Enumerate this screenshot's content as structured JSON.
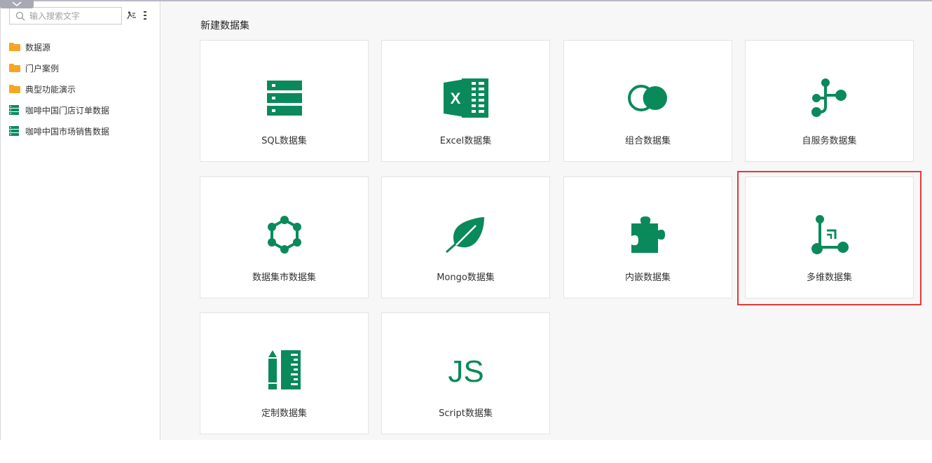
{
  "sidebar": {
    "search": {
      "placeholder": "输入搜索文字",
      "value": ""
    },
    "tree": [
      {
        "label": "数据源",
        "icon": "folder-icon"
      },
      {
        "label": "门户案例",
        "icon": "folder-icon"
      },
      {
        "label": "典型功能演示",
        "icon": "folder-icon"
      },
      {
        "label": "咖啡中国门店订单数据",
        "icon": "dataset-icon"
      },
      {
        "label": "咖啡中国市场销售数据",
        "icon": "dataset-icon"
      }
    ]
  },
  "main": {
    "title": "新建数据集",
    "cards": [
      {
        "label": "SQL数据集",
        "icon": "sql-table-icon"
      },
      {
        "label": "Excel数据集",
        "icon": "excel-icon"
      },
      {
        "label": "组合数据集",
        "icon": "combine-circles-icon"
      },
      {
        "label": "自服务数据集",
        "icon": "self-service-flow-icon"
      },
      {
        "label": "数据集市数据集",
        "icon": "hexagon-network-icon"
      },
      {
        "label": "Mongo数据集",
        "icon": "leaf-icon"
      },
      {
        "label": "内嵌数据集",
        "icon": "puzzle-icon"
      },
      {
        "label": "多维数据集",
        "icon": "cube-axis-icon"
      },
      {
        "label": "定制数据集",
        "icon": "pencil-ruler-icon"
      },
      {
        "label": "Script数据集",
        "icon": "js-icon"
      }
    ]
  },
  "colors": {
    "accent_green": "#0a8a5a",
    "folder_orange": "#f5a623",
    "highlight_red": "#e53935"
  }
}
